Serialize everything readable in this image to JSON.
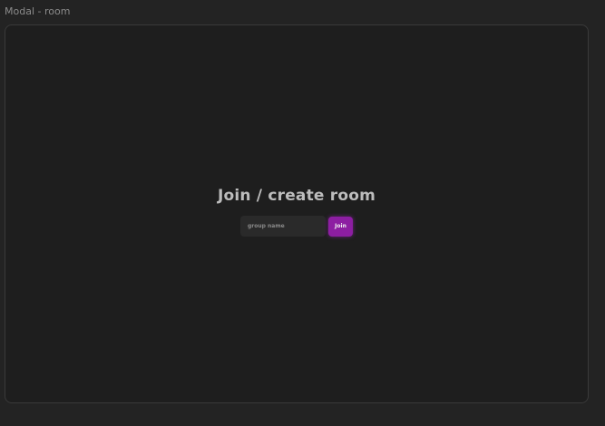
{
  "canvas": {
    "frame_label": "Modal - room"
  },
  "modal": {
    "title": "Join / create room",
    "group_input": {
      "value": "",
      "placeholder": "group name"
    },
    "join_label": "Join"
  },
  "colors": {
    "background": "#232323",
    "frame": "#1e1e1e",
    "accent": "#8d1ea2"
  }
}
